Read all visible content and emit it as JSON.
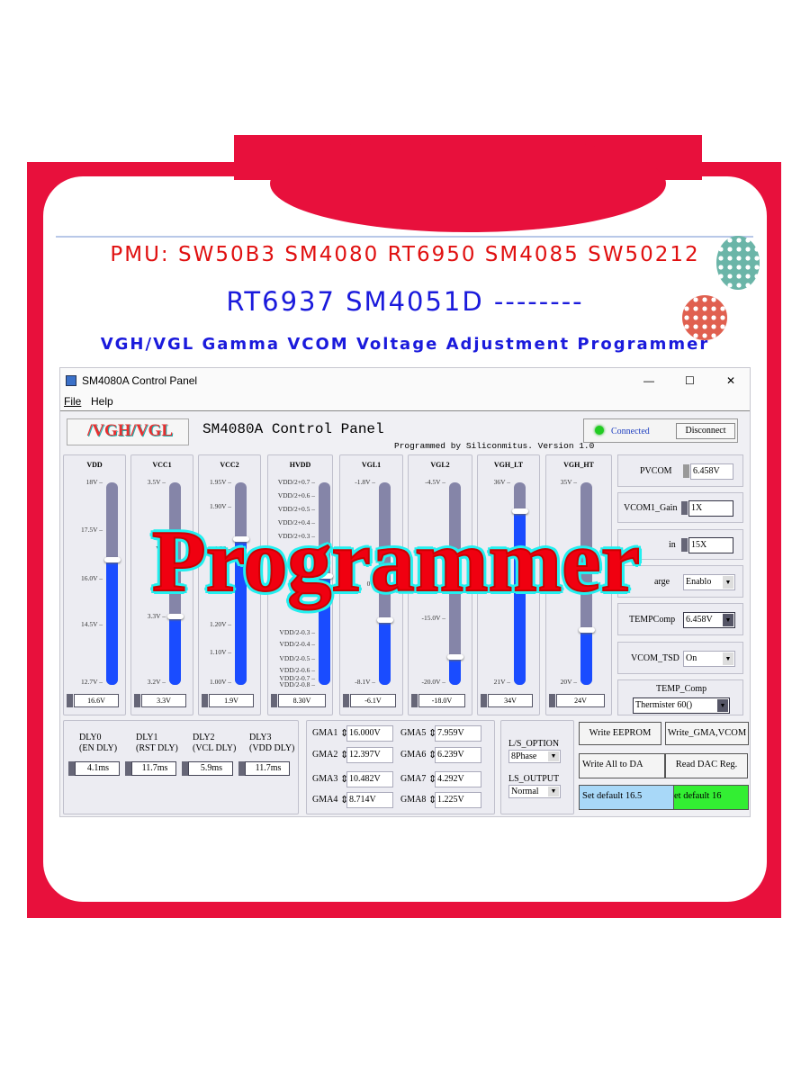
{
  "banner": {
    "line1": "PMU: SW50B3 SM4080 RT6950 SM4085 SW50212",
    "line2": "RT6937 SM4051D --------",
    "line3": "VGH/VGL Gamma VCOM Voltage Adjustment Programmer",
    "overlay": "Programmer",
    "frame_color": "#e8103c"
  },
  "window": {
    "title": "SM4080A Control Panel",
    "minimize": "—",
    "maximize": "☐",
    "close": "✕",
    "menu": [
      "File",
      "Help"
    ]
  },
  "header": {
    "tab_label": "/VGH/VGL",
    "panel_title": "SM4080A Control Panel",
    "credit": "Programmed by Siliconmitus. Version 1.0",
    "status": "Connected",
    "status_color": "#22cc22",
    "disconnect": "Disconnect"
  },
  "sliders": [
    {
      "name": "VDD",
      "value": "16.6V",
      "level": 0.62,
      "ticks": [
        "18V",
        "17.5V",
        "16.0V",
        "14.5V",
        "12.7V"
      ]
    },
    {
      "name": "VCC1",
      "value": "3.3V",
      "level": 0.34,
      "ticks": [
        "3.5V",
        "V",
        "3.3V",
        "3.2V"
      ]
    },
    {
      "name": "VCC2",
      "value": "1.9V",
      "level": 0.72,
      "ticks": [
        "1.95V",
        "1.90V",
        "1.30",
        "1.25V",
        "1.20V",
        "1.10V",
        "1.00V"
      ]
    },
    {
      "name": "HVDD",
      "value": "8.30V",
      "level": 0.54,
      "ticks": [
        "VDD/2+0.7",
        "VDD/2+0.6",
        "VDD/2+0.5",
        "VDD/2+0.4",
        "VDD/2+0.3",
        "VDD/2-0.3",
        "VDD/2-0.4",
        "VDD/2-0.5",
        "VDD/2-0.6",
        "VDD/2-0.7",
        "VDD/2-0.8"
      ]
    },
    {
      "name": "VGL1",
      "value": "-6.1V",
      "level": 0.32,
      "ticks": [
        "-1.8V",
        "0",
        "-8.1V"
      ]
    },
    {
      "name": "VGL2",
      "value": "-18.0V",
      "level": 0.14,
      "ticks": [
        "-4.5V",
        "-15.0V",
        "-20.0V"
      ]
    },
    {
      "name": "VGH_LT",
      "value": "34V",
      "level": 0.86,
      "ticks": [
        "36V",
        "30",
        "21V"
      ]
    },
    {
      "name": "VGH_HT",
      "value": "24V",
      "level": 0.27,
      "ticks": [
        "35V",
        "20V"
      ]
    }
  ],
  "right": {
    "pvcom": {
      "label": "PVCOM",
      "value": "6.458V"
    },
    "vcom1_gain": {
      "label": "VCOM1_Gain",
      "value": "1X"
    },
    "vcom2_gain": {
      "label": "in",
      "value": "15X"
    },
    "charge": {
      "label": "arge",
      "value": "Enablo"
    },
    "tempcomp": {
      "label": "TEMPComp",
      "value": "6.458V"
    },
    "vcom_tsd": {
      "label": "VCOM_TSD",
      "value": "On"
    },
    "temp_comp": {
      "label": "TEMP_Comp",
      "value": "Thermister 60()"
    }
  },
  "delays": [
    {
      "name": "DLY0",
      "sub": "(EN DLY)",
      "value": "4.1ms"
    },
    {
      "name": "DLY1",
      "sub": "(RST DLY)",
      "value": "11.7ms"
    },
    {
      "name": "DLY2",
      "sub": "(VCL DLY)",
      "value": "5.9ms"
    },
    {
      "name": "DLY3",
      "sub": "(VDD DLY)",
      "value": "11.7ms"
    }
  ],
  "gamma": [
    {
      "name": "GMA1",
      "value": "16.000V"
    },
    {
      "name": "GMA2",
      "value": "12.397V"
    },
    {
      "name": "GMA3",
      "value": "10.482V"
    },
    {
      "name": "GMA4",
      "value": "8.714V"
    },
    {
      "name": "GMA5",
      "value": "7.959V"
    },
    {
      "name": "GMA6",
      "value": "6.239V"
    },
    {
      "name": "GMA7",
      "value": "4.292V"
    },
    {
      "name": "GMA8",
      "value": "1.225V"
    }
  ],
  "ls": {
    "option_label": "L/S_OPTION",
    "option_value": "8Phase",
    "output_label": "LS_OUTPUT",
    "output_value": "Normal"
  },
  "buttons": {
    "write_eeprom": "Write EEPROM",
    "write_gma": "Write_GMA,VCOM",
    "write_all": "Write All to DA",
    "read_dac": "Read DAC Reg.",
    "set_default_a": "Set default 16.5",
    "set_default_b": "et default 16",
    "set_default_a_color": "#a8d8f8",
    "set_default_b_color": "#33ee33"
  }
}
